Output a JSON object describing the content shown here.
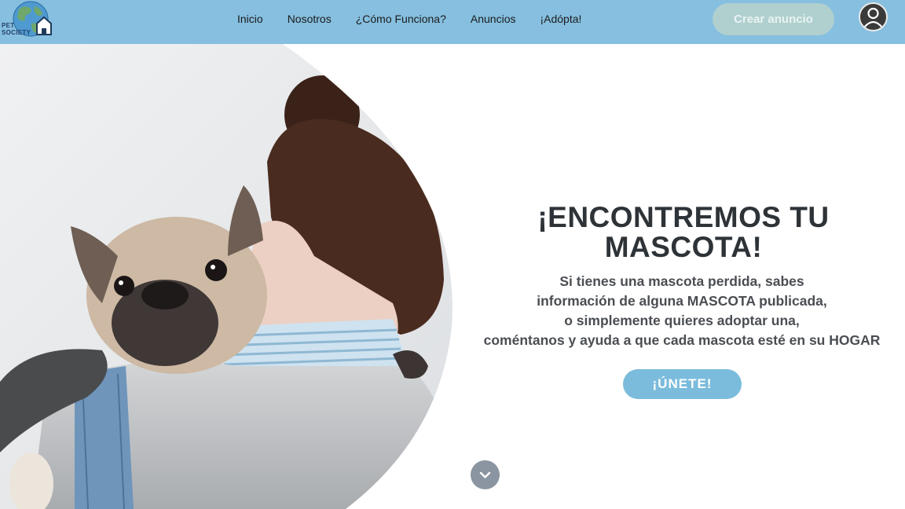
{
  "logo": {
    "text_line1": "PET",
    "text_line2": "SOCIETY"
  },
  "nav": {
    "links": [
      {
        "label": "Inicio"
      },
      {
        "label": "Nosotros"
      },
      {
        "label": "¿Cómo Funciona?"
      },
      {
        "label": "Anuncios"
      },
      {
        "label": "¡Adópta!"
      }
    ],
    "create_button_label": "Crear anuncio"
  },
  "hero": {
    "title": "¡ENCONTREMOS TU MASCOTA!",
    "description_lines": [
      "Si tienes una mascota perdida, sabes",
      "información de alguna MASCOTA publicada,",
      "o simplemente quieres adoptar una,",
      "coméntanos y ayuda a que cada mascota esté en su HOGAR"
    ],
    "join_button_label": "¡ÚNETE!"
  },
  "icons": {
    "logo": "globe-house-logo",
    "avatar": "user-icon",
    "scroll": "chevron-down-icon"
  },
  "colors": {
    "navbar": "#86bfdf",
    "create_button": "#b0d0cf",
    "join_button": "#7bbcdc",
    "title": "#2e3338",
    "scroll_button": "#8b95a1"
  }
}
